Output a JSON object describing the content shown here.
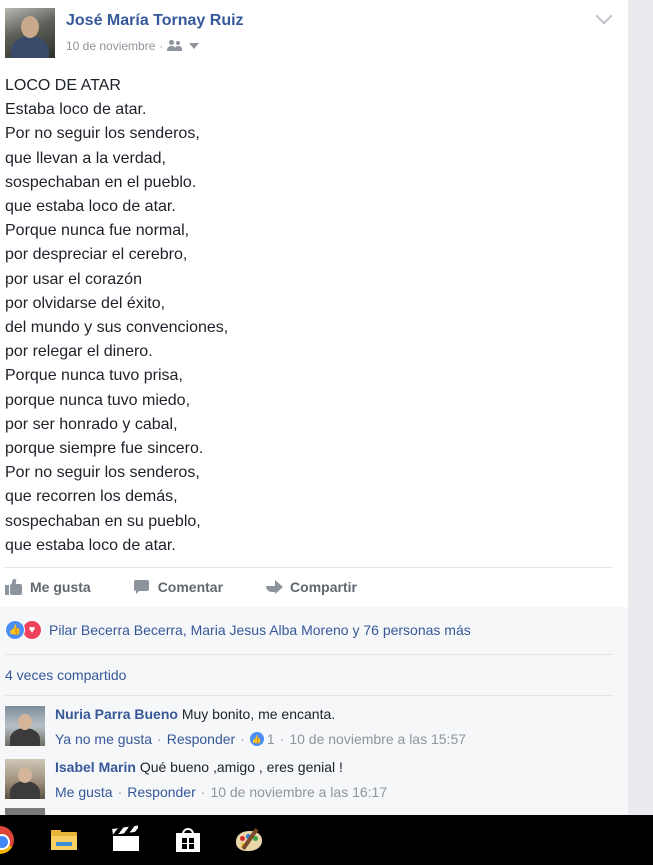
{
  "post": {
    "author": "José María Tornay Ruiz",
    "date": "10 de noviembre",
    "date_separator": "·",
    "poem_lines": [
      "LOCO DE ATAR",
      "Estaba loco de atar.",
      "Por no seguir los senderos,",
      "que llevan a la verdad,",
      "sospechaban en el pueblo.",
      "que estaba loco de atar.",
      "Porque nunca fue normal,",
      "por despreciar el cerebro,",
      "por usar el corazón",
      "por olvidarse del éxito,",
      "del mundo y sus convenciones,",
      "por relegar el dinero.",
      "Porque nunca tuvo prisa,",
      "porque nunca tuvo miedo,",
      "por ser honrado y cabal,",
      "porque siempre fue sincero.",
      "Por no seguir los senderos,",
      "que recorren los demás,",
      "sospechaban en su pueblo,",
      "que estaba loco de atar."
    ]
  },
  "actions": {
    "like": "Me gusta",
    "comment": "Comentar",
    "share": "Compartir"
  },
  "reactions": {
    "summary": "Pilar Becerra Becerra, Maria Jesus Alba Moreno y 76 personas más"
  },
  "shares_text": "4 veces compartido",
  "comments": [
    {
      "name": "Nuria Parra Bueno",
      "text": "Muy bonito, me encanta.",
      "like_label": "Ya no me gusta",
      "reply_label": "Responder",
      "like_count": "1",
      "timestamp": "10 de noviembre a las 15:57"
    },
    {
      "name": "Isabel Marin",
      "text": "Qué bueno ,amigo , eres genial !",
      "like_label": "Me gusta",
      "reply_label": "Responder",
      "timestamp": "10 de noviembre a las 16:17"
    }
  ],
  "separator": "·",
  "icons": {
    "privacy": "friends-icon",
    "options": "chevron-down-icon",
    "taskbar": [
      "chrome-icon",
      "file-explorer-icon",
      "movie-maker-icon",
      "store-icon",
      "paint-icon"
    ]
  },
  "colors": {
    "link": "#365899",
    "meta": "#90949c",
    "like_reaction": "#4a8ff7",
    "love_reaction": "#f0425b",
    "taskbar": "#000000"
  }
}
